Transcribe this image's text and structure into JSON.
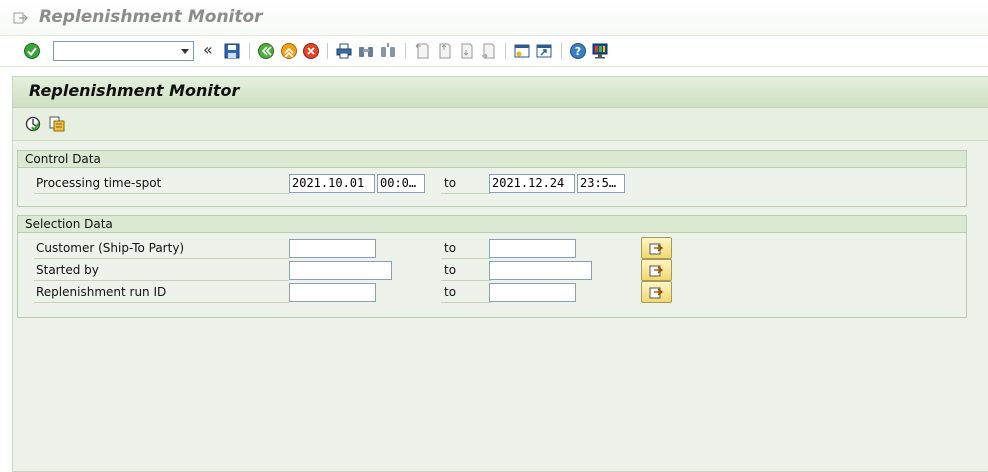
{
  "window": {
    "title": "Replenishment Monitor"
  },
  "toolbar": {
    "command_value": "",
    "command_placeholder": "",
    "buttons": [
      "enter",
      "save",
      "back",
      "exit",
      "cancel",
      "print",
      "find",
      "find-next",
      "first-page",
      "previous-page",
      "next-page",
      "last-page",
      "create-session",
      "generate-shortcut",
      "help",
      "customize-layout"
    ]
  },
  "screen": {
    "title": "Replenishment Monitor",
    "app_toolbar": [
      "execute",
      "get-variant"
    ]
  },
  "control_data": {
    "title": "Control Data",
    "processing_time_spot": {
      "label": "Processing time-spot",
      "from_date": "2021.10.01",
      "from_time": "00:0…",
      "to_label": "to",
      "to_date": "2021.12.24",
      "to_time": "23:5…"
    }
  },
  "selection_data": {
    "title": "Selection Data",
    "rows": [
      {
        "label": "Customer (Ship-To Party)",
        "from": "",
        "to_label": "to",
        "to": ""
      },
      {
        "label": "Started by",
        "from": "",
        "to_label": "to",
        "to": ""
      },
      {
        "label": "Replenishment run ID",
        "from": "",
        "to_label": "to",
        "to": ""
      }
    ]
  },
  "colors": {
    "panel_bg": "#edf3ea",
    "header_green": "#cfe1c4",
    "multiple_selection_button": "#f1d86f"
  }
}
